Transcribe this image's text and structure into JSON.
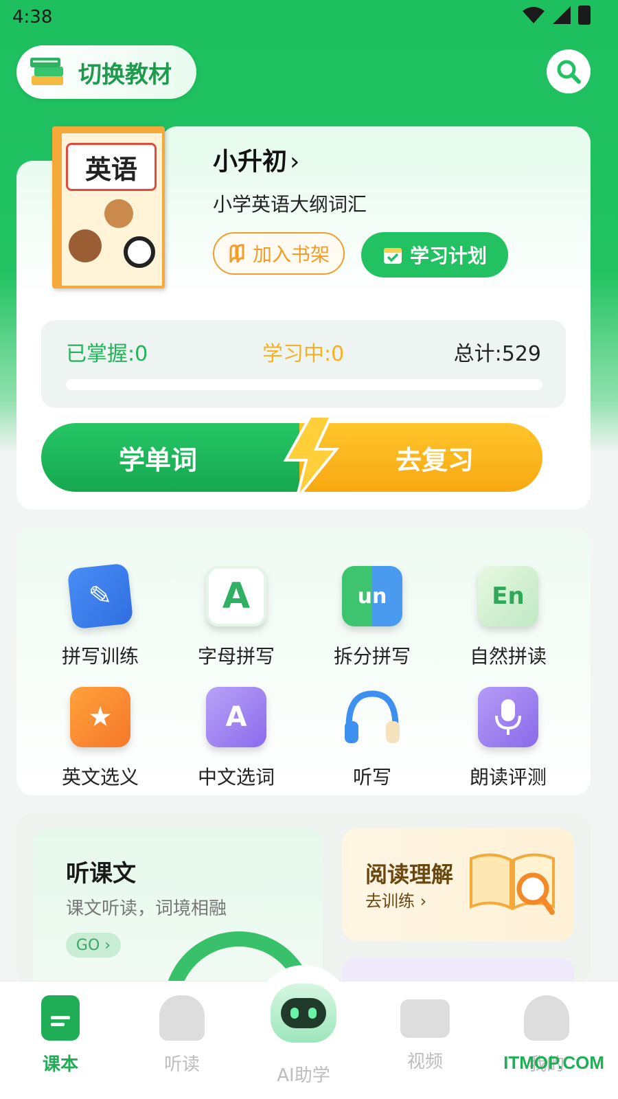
{
  "status": {
    "time": "4:38"
  },
  "header": {
    "switch_label": "切换教材"
  },
  "book": {
    "cover_title": "英语",
    "title": "小升初",
    "title_chevron": "›",
    "subtitle": "小学英语大纲词汇",
    "shelf_label": "加入书架",
    "plan_label": "学习计划"
  },
  "progress": {
    "mastered": "已掌握:0",
    "learning": "学习中:0",
    "total": "总计:529",
    "fill_fraction": 0
  },
  "actions": {
    "learn": "学单词",
    "review": "去复习"
  },
  "tools": [
    {
      "label": "拼写训练",
      "icon": "pencil-icon",
      "glyph": "✎"
    },
    {
      "label": "字母拼写",
      "icon": "letter-a-icon",
      "glyph": "A"
    },
    {
      "label": "拆分拼写",
      "icon": "split-un-icon",
      "glyph": "un"
    },
    {
      "label": "自然拼读",
      "icon": "en-book-icon",
      "glyph": "En"
    },
    {
      "label": "英文选义",
      "icon": "star-book-icon",
      "glyph": "★"
    },
    {
      "label": "中文选词",
      "icon": "a-book-icon",
      "glyph": "A"
    },
    {
      "label": "听写",
      "icon": "headphones-icon",
      "glyph": ""
    },
    {
      "label": "朗读评测",
      "icon": "microphone-icon",
      "glyph": "🎙"
    }
  ],
  "listen_card": {
    "title": "听课文",
    "subtitle": "课文听读，词境相融",
    "go": "GO ›"
  },
  "reading_card": {
    "title": "阅读理解",
    "subtitle": "去训练 ›"
  },
  "tabbar": [
    {
      "label": "课本",
      "icon": "textbook-icon",
      "active": true
    },
    {
      "label": "听读",
      "icon": "listen-read-icon",
      "active": false
    },
    {
      "label": "AI助学",
      "icon": "ai-robot-icon",
      "active": false
    },
    {
      "label": "视频",
      "icon": "video-icon",
      "active": false
    },
    {
      "label": "我的",
      "icon": "profile-icon",
      "active": false
    }
  ],
  "watermark": "ITMOP.COM",
  "colors": {
    "brand": "#22c262",
    "orange": "#f29c2a",
    "yellow": "#f6b121"
  }
}
